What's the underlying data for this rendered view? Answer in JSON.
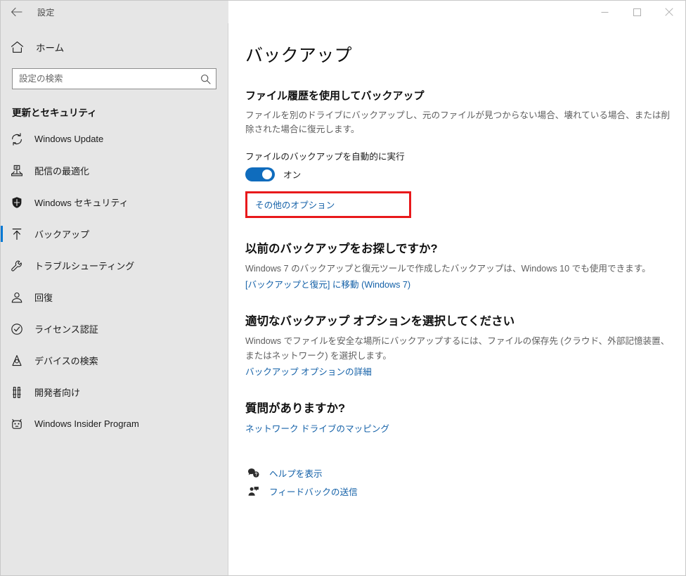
{
  "window": {
    "app_title": "設定",
    "back_icon": "back-arrow-icon",
    "controls": {
      "minimize": "minimize-icon",
      "maximize": "maximize-icon",
      "close": "close-icon"
    }
  },
  "sidebar": {
    "home": {
      "label": "ホーム",
      "icon": "home-icon"
    },
    "search": {
      "placeholder": "設定の検索",
      "value": "",
      "icon": "search-icon"
    },
    "category_label": "更新とセキュリティ",
    "items": [
      {
        "label": "Windows Update",
        "icon": "sync-icon",
        "selected": false
      },
      {
        "label": "配信の最適化",
        "icon": "delivery-optimization-icon",
        "selected": false
      },
      {
        "label": "Windows セキュリティ",
        "icon": "shield-icon",
        "selected": false
      },
      {
        "label": "バックアップ",
        "icon": "backup-upload-icon",
        "selected": true
      },
      {
        "label": "トラブルシューティング",
        "icon": "wrench-icon",
        "selected": false
      },
      {
        "label": "回復",
        "icon": "recovery-icon",
        "selected": false
      },
      {
        "label": "ライセンス認証",
        "icon": "check-circle-icon",
        "selected": false
      },
      {
        "label": "デバイスの検索",
        "icon": "find-device-icon",
        "selected": false
      },
      {
        "label": "開発者向け",
        "icon": "developer-tools-icon",
        "selected": false
      },
      {
        "label": "Windows Insider Program",
        "icon": "insider-cat-icon",
        "selected": false
      }
    ]
  },
  "main": {
    "page_title": "バックアップ",
    "file_history": {
      "heading": "ファイル履歴を使用してバックアップ",
      "description": "ファイルを別のドライブにバックアップし、元のファイルが見つからない場合、壊れている場合、または削除された場合に復元します。",
      "toggle_label": "ファイルのバックアップを自動的に実行",
      "toggle_state": "オン",
      "toggle_on": true,
      "more_options_link": "その他のオプション",
      "highlight_color": "#e8191b"
    },
    "previous_backup": {
      "heading": "以前のバックアップをお探しですか?",
      "description": "Windows 7 のバックアップと復元ツールで作成したバックアップは、Windows 10 でも使用できます。",
      "link": "[バックアップと復元] に移動 (Windows 7)"
    },
    "choose_option": {
      "heading": "適切なバックアップ オプションを選択してください",
      "description": "Windows でファイルを安全な場所にバックアップするには、ファイルの保存先 (クラウド、外部記憶装置、またはネットワーク) を選択します。",
      "link": "バックアップ オプションの詳細"
    },
    "questions": {
      "heading": "質問がありますか?",
      "link": "ネットワーク ドライブのマッピング"
    },
    "help_links": [
      {
        "label": "ヘルプを表示",
        "icon": "help-speech-icon"
      },
      {
        "label": "フィードバックの送信",
        "icon": "feedback-person-icon"
      }
    ]
  },
  "colors": {
    "accent": "#0078d4",
    "link": "#1461a8",
    "toggle_on": "#0f6cbd",
    "highlight": "#e8191b",
    "sidebar_bg": "#e6e6e6"
  }
}
